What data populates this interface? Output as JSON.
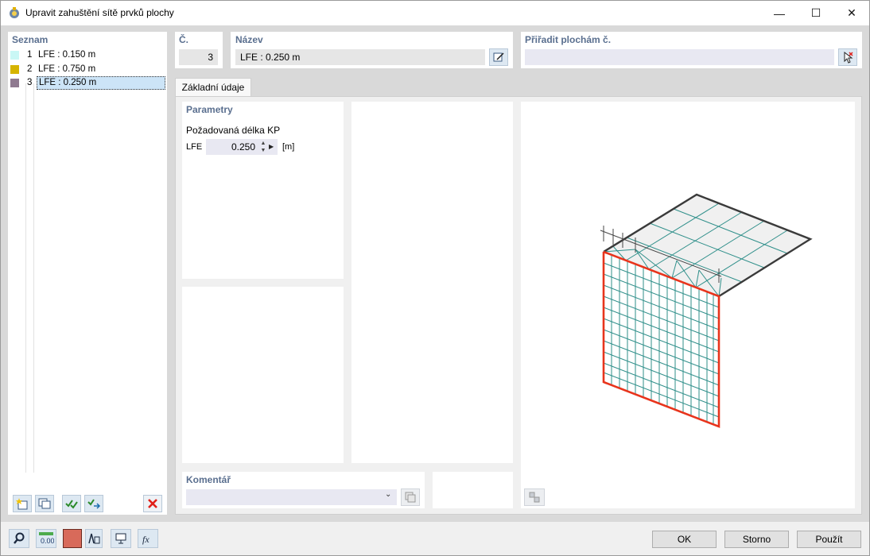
{
  "window": {
    "title": "Upravit zahuštění sítě prvků plochy",
    "minimize_label": "—",
    "maximize_label": "☐",
    "close_label": "✕"
  },
  "list": {
    "header": "Seznam",
    "items": [
      {
        "num": "1",
        "label": "LFE : 0.150 m",
        "color": "#c9f7f5"
      },
      {
        "num": "2",
        "label": "LFE : 0.750 m",
        "color": "#d6b400"
      },
      {
        "num": "3",
        "label": "LFE : 0.250 m",
        "color": "#8f7a90"
      }
    ]
  },
  "number": {
    "label": "Č.",
    "value": "3"
  },
  "name": {
    "label": "Název",
    "value": "LFE : 0.250 m"
  },
  "assign": {
    "label": "Přiřadit plochám č.",
    "value": ""
  },
  "tabs": [
    {
      "label": "Základní údaje"
    }
  ],
  "parameters": {
    "header": "Parametry",
    "required_length_label": "Požadovaná délka KP",
    "symbol": "LFE",
    "value": "0.250",
    "unit": "[m]"
  },
  "comment": {
    "label": "Komentář",
    "value": ""
  },
  "footer": {
    "ok": "OK",
    "cancel": "Storno",
    "apply": "Použít"
  },
  "colors": {
    "accent": "#5a6f8f",
    "selection": "#cce4f7",
    "mesh": "#2f8f8a",
    "edge": "#e8341c",
    "swatch": "#d86a5a"
  }
}
